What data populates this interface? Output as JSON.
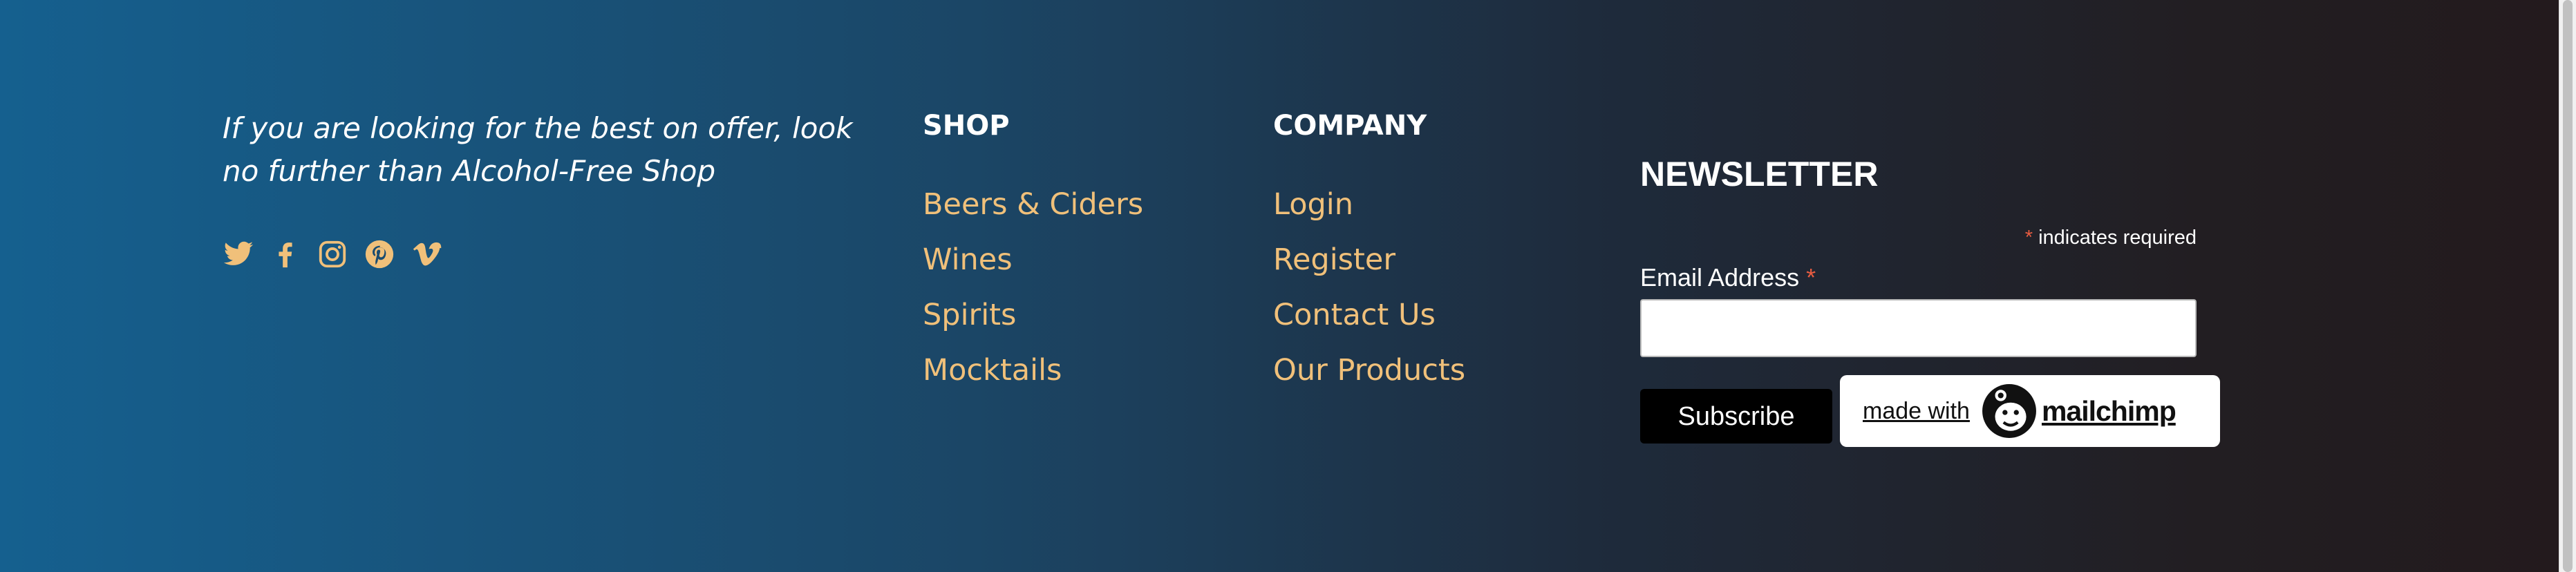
{
  "footer": {
    "tagline": "If you are looking for the best on offer, look no further than Alcohol-Free Shop",
    "social": [
      "twitter-icon",
      "facebook-icon",
      "instagram-icon",
      "pinterest-icon",
      "vimeo-icon"
    ],
    "shop": {
      "title": "SHOP",
      "links": [
        "Beers & Ciders",
        "Wines",
        "Spirits",
        "Mocktails"
      ]
    },
    "company": {
      "title": "COMPANY",
      "links": [
        "Login",
        "Register",
        "Contact Us",
        "Our Products"
      ]
    },
    "newsletter": {
      "title": "NEWSLETTER",
      "required_star": "*",
      "required_note": "indicates required",
      "email_label": "Email Address",
      "email_value": "",
      "subscribe_label": "Subscribe",
      "badge_prefix": "made with",
      "badge_brand": "mailchimp"
    },
    "colors": {
      "link": "#f0c07a",
      "text": "#ffffff",
      "required": "#e85c41",
      "gradient_start": "#15608f",
      "gradient_end": "#231a1d"
    }
  }
}
